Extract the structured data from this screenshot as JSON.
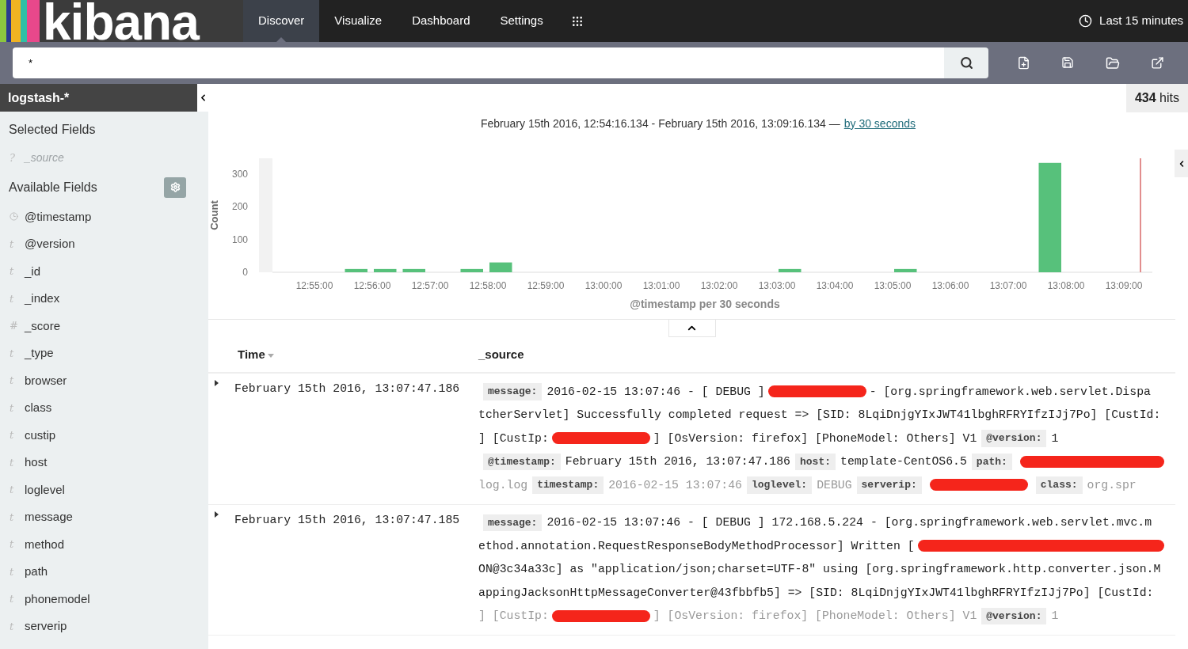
{
  "nav": {
    "logo": "kibana",
    "tabs": [
      {
        "label": "Discover",
        "selected": true
      },
      {
        "label": "Visualize",
        "selected": false
      },
      {
        "label": "Dashboard",
        "selected": false
      },
      {
        "label": "Settings",
        "selected": false
      }
    ],
    "time_picker": "Last 15 minutes"
  },
  "search": {
    "value": "*"
  },
  "sidebar": {
    "index_pattern": "logstash-*",
    "selected_title": "Selected Fields",
    "selected_fields": [
      {
        "kind": "unknown",
        "glyph": "?",
        "name": "_source"
      }
    ],
    "available_title": "Available Fields",
    "available_fields": [
      {
        "kind": "date",
        "name": "@timestamp"
      },
      {
        "kind": "string",
        "glyph": "t",
        "name": "@version"
      },
      {
        "kind": "string",
        "glyph": "t",
        "name": "_id"
      },
      {
        "kind": "string",
        "glyph": "t",
        "name": "_index"
      },
      {
        "kind": "number",
        "glyph": "#",
        "name": "_score"
      },
      {
        "kind": "string",
        "glyph": "t",
        "name": "_type"
      },
      {
        "kind": "string",
        "glyph": "t",
        "name": "browser"
      },
      {
        "kind": "string",
        "glyph": "t",
        "name": "class"
      },
      {
        "kind": "string",
        "glyph": "t",
        "name": "custip"
      },
      {
        "kind": "string",
        "glyph": "t",
        "name": "host"
      },
      {
        "kind": "string",
        "glyph": "t",
        "name": "loglevel"
      },
      {
        "kind": "string",
        "glyph": "t",
        "name": "message"
      },
      {
        "kind": "string",
        "glyph": "t",
        "name": "method"
      },
      {
        "kind": "string",
        "glyph": "t",
        "name": "path"
      },
      {
        "kind": "string",
        "glyph": "t",
        "name": "phonemodel"
      },
      {
        "kind": "string",
        "glyph": "t",
        "name": "serverip"
      }
    ]
  },
  "hits": {
    "count": "434",
    "label": "hits"
  },
  "time_range": {
    "text": "February 15th 2016, 12:54:16.134 - February 15th 2016, 13:09:16.134 —",
    "interval_link": "by 30 seconds"
  },
  "chart": {
    "expanded": true,
    "chart_data": {
      "type": "bar",
      "xlabel": "@timestamp per 30 seconds",
      "ylabel": "Count",
      "categories": [
        null,
        "12:55:00",
        null,
        "12:56:00",
        null,
        "12:57:00",
        null,
        "12:58:00",
        null,
        "12:59:00",
        null,
        "13:00:00",
        null,
        "13:01:00",
        null,
        "13:02:00",
        null,
        "13:03:00",
        null,
        "13:04:00",
        null,
        "13:05:00",
        null,
        "13:06:00",
        null,
        "13:07:00",
        null,
        "13:08:00",
        null,
        "13:09:00"
      ],
      "series": [
        {
          "color": "#57c17b",
          "values": [
            0,
            0,
            10,
            10,
            10,
            0,
            10,
            30,
            0,
            0,
            0,
            0,
            0,
            0,
            0,
            0,
            0,
            10,
            0,
            0,
            0,
            10,
            0,
            0,
            0,
            0,
            334,
            0,
            0,
            0
          ]
        }
      ],
      "yticks": [
        0,
        100,
        200,
        300
      ],
      "ylim": [
        0,
        348
      ]
    }
  },
  "table": {
    "columns": [
      {
        "label": "Time",
        "sorted": true
      },
      {
        "label": "_source",
        "sorted": false
      }
    ],
    "rows": [
      {
        "expanded": false,
        "time": "February 15th 2016, 13:07:47.186",
        "lines": [
          {
            "faded": false,
            "segments": [
              {
                "kind": "key",
                "text": "message:"
              },
              {
                "kind": "text",
                "text": "2016-02-15 13:07:46 - [ DEBUG ]"
              },
              {
                "kind": "redacted"
              },
              {
                "kind": "text",
                "text": "- [org.springframework.web.servlet.Dispa"
              }
            ]
          },
          {
            "faded": false,
            "segments": [
              {
                "kind": "text",
                "text": "tcherServlet] Successfully completed request => [SID: 8LqiDnjgYIxJWT41lbghRFRYIfzIJj7Po] [CustId:"
              }
            ]
          },
          {
            "faded": false,
            "segments": [
              {
                "kind": "text",
                "text": "] [CustIp:"
              },
              {
                "kind": "redacted"
              },
              {
                "kind": "text",
                "text": "] [OsVersion: firefox] [PhoneModel: Others] V1"
              },
              {
                "kind": "key",
                "text": "@version:"
              },
              {
                "kind": "text",
                "text": "1"
              }
            ]
          },
          {
            "faded": false,
            "segments": [
              {
                "kind": "key",
                "text": "@timestamp:"
              },
              {
                "kind": "text",
                "text": "February 15th 2016, 13:07:47.186"
              },
              {
                "kind": "key",
                "text": "host:"
              },
              {
                "kind": "text",
                "text": "template-CentOS6.5"
              },
              {
                "kind": "key",
                "text": "path:"
              },
              {
                "kind": "redacted"
              }
            ]
          },
          {
            "faded": true,
            "segments": [
              {
                "kind": "text",
                "text": "log.log"
              },
              {
                "kind": "key",
                "text": "timestamp:"
              },
              {
                "kind": "text",
                "text": "2016-02-15 13:07:46"
              },
              {
                "kind": "key",
                "text": "loglevel:"
              },
              {
                "kind": "text",
                "text": "DEBUG"
              },
              {
                "kind": "key",
                "text": "serverip:"
              },
              {
                "kind": "redacted"
              },
              {
                "kind": "key",
                "text": "class:"
              },
              {
                "kind": "text",
                "text": "org.spr"
              }
            ]
          }
        ]
      },
      {
        "expanded": false,
        "time": "February 15th 2016, 13:07:47.185",
        "lines": [
          {
            "faded": false,
            "segments": [
              {
                "kind": "key",
                "text": "message:"
              },
              {
                "kind": "text",
                "text": "2016-02-15 13:07:46 - [ DEBUG ] 172.168.5.224 - [org.springframework.web.servlet.mvc.m"
              }
            ]
          },
          {
            "faded": false,
            "segments": [
              {
                "kind": "text",
                "text": "ethod.annotation.RequestResponseBodyMethodProcessor] Written ["
              },
              {
                "kind": "redacted"
              }
            ]
          },
          {
            "faded": false,
            "segments": [
              {
                "kind": "text",
                "text": "ON@3c34a33c] as \"application/json;charset=UTF-8\" using [org.springframework.http.converter.json.M"
              }
            ]
          },
          {
            "faded": false,
            "segments": [
              {
                "kind": "text",
                "text": "appingJacksonHttpMessageConverter@43fbbfb5] => [SID: 8LqiDnjgYIxJWT41lbghRFRYIfzIJj7Po] [CustId:"
              }
            ]
          },
          {
            "faded": true,
            "segments": [
              {
                "kind": "text",
                "text": "] [CustIp:"
              },
              {
                "kind": "redacted"
              },
              {
                "kind": "text",
                "text": "] [OsVersion: firefox] [PhoneModel: Others] V1"
              },
              {
                "kind": "key",
                "text": "@version:"
              },
              {
                "kind": "text",
                "text": "1"
              }
            ]
          }
        ]
      }
    ]
  }
}
